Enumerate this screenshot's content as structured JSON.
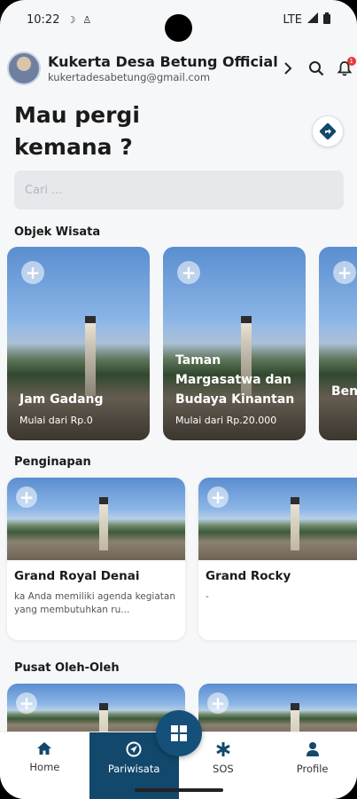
{
  "status": {
    "time": "10:22",
    "network": "LTE"
  },
  "header": {
    "title": "Kukerta Desa Betung Official",
    "email": "kukertadesabetung@gmail.com",
    "notification_count": "1"
  },
  "hero": {
    "line1": "Mau pergi",
    "line2": "kemana ?"
  },
  "search": {
    "placeholder": "Cari ..."
  },
  "sections": {
    "wisata": "Objek Wisata",
    "penginapan": "Penginapan",
    "oleh": "Pusat Oleh-Oleh"
  },
  "wisata": [
    {
      "name": "Jam Gadang",
      "price": "Mulai dari Rp.0"
    },
    {
      "name": "Taman Margasatwa dan Budaya Kinantan",
      "price": "Mulai dari Rp.20.000"
    },
    {
      "name": "Ben Koa",
      "price": ""
    }
  ],
  "penginapan": [
    {
      "name": "Grand Royal Denai",
      "desc": "ka Anda memiliki agenda kegiatan yang membutuhkan ru..."
    },
    {
      "name": "Grand Rocky",
      "desc": "-"
    }
  ],
  "nav": {
    "home": "Home",
    "pariwisata": "Pariwisata",
    "sos": "SOS",
    "profile": "Profile"
  },
  "colors": {
    "primary": "#12486b",
    "badge": "#e53935"
  }
}
